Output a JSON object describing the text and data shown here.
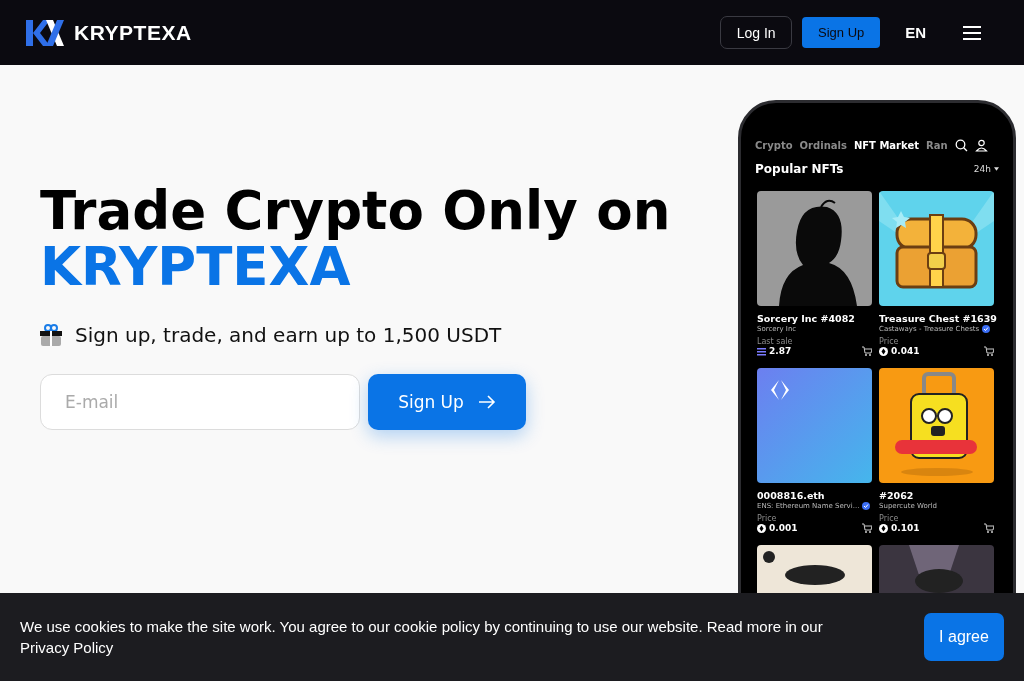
{
  "header": {
    "brand": "KRYPTEXA",
    "login": "Log In",
    "signup": "Sign Up",
    "language": "EN"
  },
  "hero": {
    "title": "Trade Crypto Only on",
    "brand": "KRYPTEXA",
    "offer": "Sign up, trade, and earn up to 1,500 USDT",
    "email": {
      "placeholder": "E-mail"
    },
    "submit": "Sign Up"
  },
  "phone": {
    "tabs": [
      {
        "label": "Crypto",
        "selected": false
      },
      {
        "label": "Ordinals",
        "selected": false
      },
      {
        "label": "NFT Market",
        "selected": true
      },
      {
        "label": "Ran",
        "selected": false
      }
    ],
    "section_title": "Popular NFTs",
    "period": "24h",
    "cards": [
      {
        "image": {
          "kind": "silhouette"
        },
        "title": "Sorcery Inc #4082",
        "collection": "Sorcery Inc",
        "verified": false,
        "price_label": "Last sale",
        "price": {
          "kind": "stack",
          "value": "2.87"
        }
      },
      {
        "image": {
          "kind": "chest"
        },
        "title": "Treasure Chest #1639",
        "collection": "Castaways - Treasure Chests",
        "verified": true,
        "price_label": "Price",
        "price": {
          "kind": "coin",
          "value": "0.041"
        }
      },
      {
        "image": {
          "kind": "gradient"
        },
        "title": "0008816.eth",
        "collection": "ENS: Ethereum Name Servi...",
        "verified": true,
        "price_label": "Price",
        "price": {
          "kind": "coin",
          "value": "0.001"
        }
      },
      {
        "image": {
          "kind": "suitcase"
        },
        "title": "#2062",
        "collection": "Supercute World",
        "verified": false,
        "price_label": "Price",
        "price": {
          "kind": "coin",
          "value": "0.101"
        }
      },
      {
        "image": {
          "kind": "beige"
        }
      },
      {
        "image": {
          "kind": "dusk"
        }
      }
    ]
  },
  "cookie": {
    "text": "We use cookies to make the site work. You agree to our cookie policy by continuing to use our website. Read more in our",
    "link": "Privacy Policy",
    "accept": "I agree"
  }
}
